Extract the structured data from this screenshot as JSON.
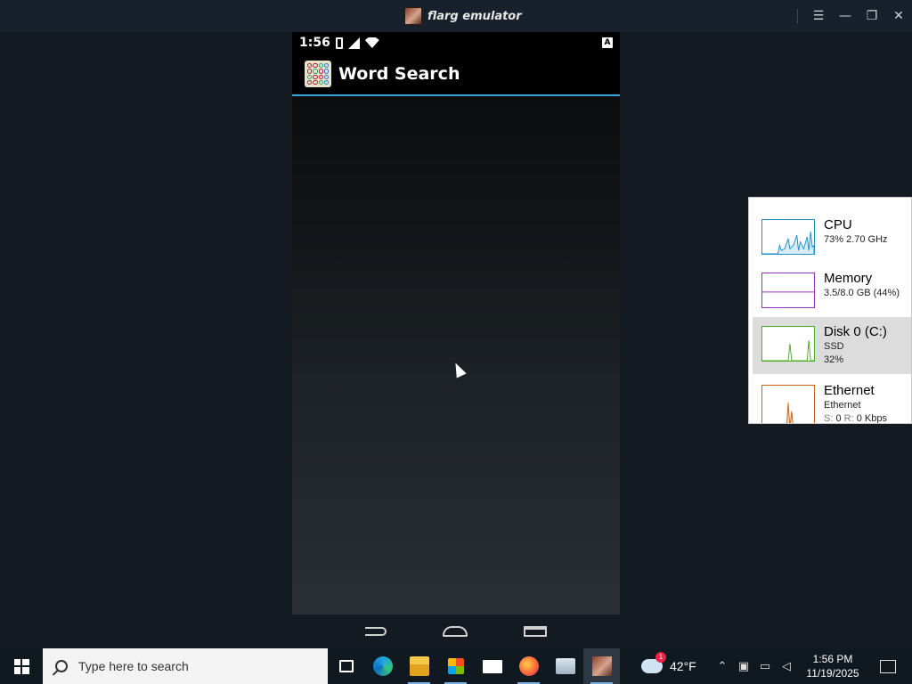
{
  "window": {
    "title": "flarg emulator"
  },
  "phone": {
    "status_time": "1:56",
    "status_badge": "A",
    "app_title": "Word Search"
  },
  "perf": {
    "cpu": {
      "name": "CPU",
      "line1": "73% 2.70 GHz",
      "color": "#1e90c8"
    },
    "memory": {
      "name": "Memory",
      "line1": "3.5/8.0 GB (44%)",
      "color": "#9b30c0"
    },
    "disk": {
      "name": "Disk 0 (C:)",
      "line1": "SSD",
      "line2": "32%",
      "color": "#4caf20"
    },
    "ethernet": {
      "name": "Ethernet",
      "line1": "Ethernet",
      "send_label": "S:",
      "send_value": "0",
      "recv_label": "R:",
      "recv_value": "0 Kbps",
      "color": "#c86414"
    }
  },
  "taskbar": {
    "search_placeholder": "Type here to search",
    "weather_temp": "42°F",
    "weather_badge": "1",
    "clock_time": "1:56 PM",
    "clock_date": "11/19/2025"
  }
}
